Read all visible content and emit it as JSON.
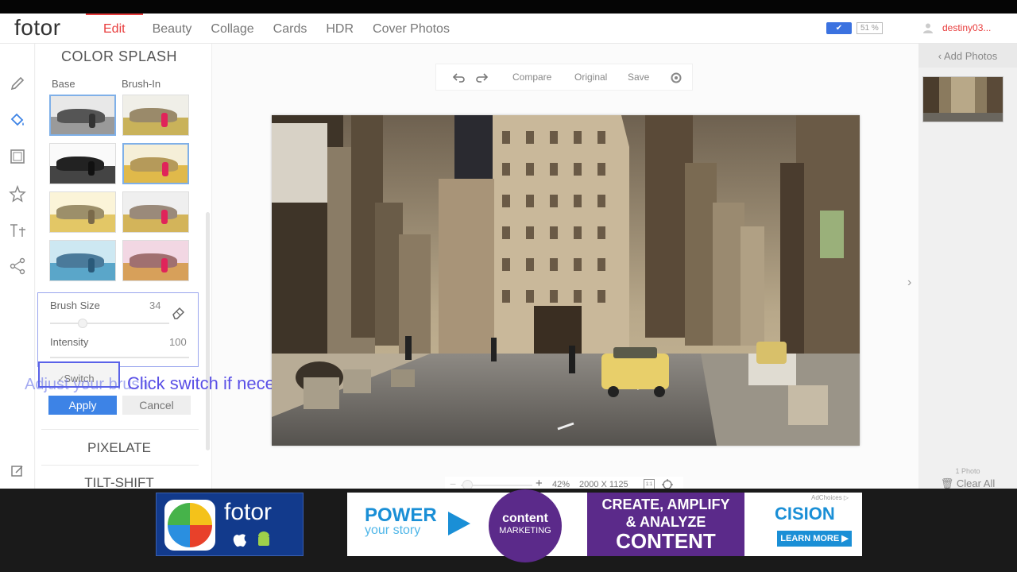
{
  "app": {
    "logo": "fotor"
  },
  "nav": {
    "tabs": [
      "Edit",
      "Beauty",
      "Collage",
      "Cards",
      "HDR",
      "Cover Photos"
    ],
    "active_index": 0
  },
  "header_right": {
    "quota_badge": "✔",
    "quota_count": "51 %",
    "username": "destiny03..."
  },
  "panel": {
    "title": "COLOR SPLASH",
    "base_label": "Base",
    "brush_in_label": "Brush-In",
    "brush_size_label": "Brush Size",
    "brush_size_value": "34",
    "intensity_label": "Intensity",
    "intensity_value": "100",
    "switch_label": "Switch",
    "switch_check": "✓",
    "apply_label": "Apply",
    "cancel_label": "Cancel",
    "pixelate_label": "PIXELATE",
    "tiltshift_label": "TILT-SHIFT"
  },
  "overlays": {
    "hint_faded": "Adjust your brush.",
    "hint_main": "Click switch if necessary"
  },
  "toolbar": {
    "compare": "Compare",
    "original": "Original",
    "save": "Save"
  },
  "zoom": {
    "minus": "−",
    "plus": "+",
    "percent": "42%",
    "dimensions": "2000 X 1125",
    "fit_label": "1:1"
  },
  "right_panel": {
    "add_photos": "Add Photos",
    "photo_count": "1 Photo",
    "clear_all": "Clear All",
    "next_arrow": "›"
  },
  "ads": {
    "fotor_name": "fotor",
    "power": "POWER",
    "your_story": "your story",
    "circle_top": "content",
    "circle_bottom": "MARKETING",
    "purple_l1": "CREATE, AMPLIFY",
    "purple_l2": "& ANALYZE",
    "purple_l3": "CONTENT",
    "cision": "CISION",
    "learn_more": "LEARN MORE ▶",
    "ad_choices": "AdChoices ▷"
  },
  "colors": {
    "accent_red": "#e83c3c",
    "accent_blue": "#3d83e6",
    "overlay_text": "#5a50e6",
    "cision_blue": "#1a8fd6",
    "ad_purple": "#5b2a8a"
  }
}
